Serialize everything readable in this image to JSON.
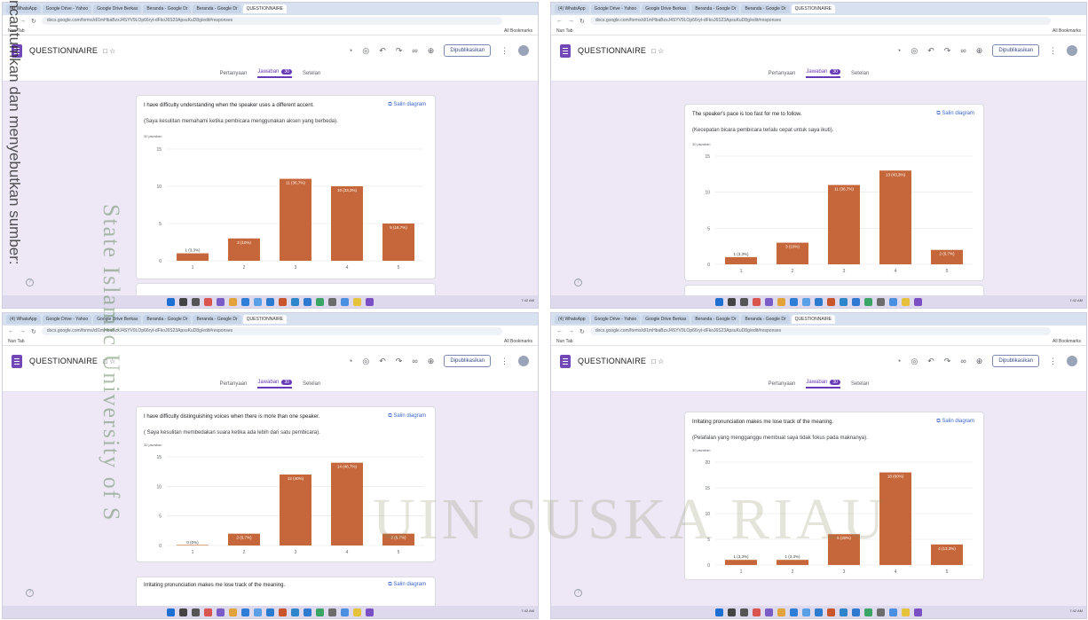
{
  "browser": {
    "tabs": [
      "(4) WhatsApp",
      "Google Drive - Yahoo",
      "Google Drive Berkas",
      "Beranda - Google Dr",
      "Beranda - Google Dr",
      "QUESTIONNAIRE"
    ],
    "url": "docs.google.com/forms/d/1mHbaBzxJ4SYV9LOp66ryt-dFkoJ6S23ApsuKuD8g/edit#responses",
    "bookmark": "Nun Tab",
    "bookmark_right": "All Bookmarks"
  },
  "forms": {
    "title": "QUESTIONNAIRE",
    "publish": "Dipublikasikan",
    "tab_questions": "Pertanyaan",
    "tab_responses": "Jawaban",
    "responses_badge": "30",
    "tab_settings": "Setelan",
    "copy_chart": "Salin diagram"
  },
  "panels": [
    {
      "question": "I have difficulty understanding when the speaker uses a different accent.",
      "translation": "(Saya kesulitan memahami ketika pembicara menggunakan aksen yang berbeda).",
      "responses": "30 jawaban",
      "chart_data": {
        "type": "bar",
        "categories": [
          "1",
          "2",
          "3",
          "4",
          "5"
        ],
        "values": [
          1,
          3,
          11,
          10,
          5
        ],
        "labels": [
          "1 (3,3%)",
          "3 (10%)",
          "11 (36,7%)",
          "10 (33,3%)",
          "5 (16,7%)"
        ],
        "yticks": [
          0,
          5,
          10,
          15
        ],
        "ylim": [
          0,
          15
        ]
      }
    },
    {
      "question": "The speaker's pace is too fast for me to follow.",
      "translation": "(Kecepatan bicara pembicara terlalu cepat untuk saya ikuti).",
      "responses": "30 jawaban",
      "chart_data": {
        "type": "bar",
        "categories": [
          "1",
          "2",
          "3",
          "4",
          "5"
        ],
        "values": [
          1,
          3,
          11,
          13,
          2
        ],
        "labels": [
          "1 (3,3%)",
          "3 (10%)",
          "11 (36,7%)",
          "13 (43,3%)",
          "2 (6,7%)"
        ],
        "yticks": [
          0,
          5,
          10,
          15
        ],
        "ylim": [
          0,
          15
        ]
      }
    },
    {
      "question": "I have difficulty distinguishing voices when there is more than one speaker.",
      "translation": "( Saya kesulitan membedakan suara ketika ada lebih dari satu pembicara).",
      "responses": "30 jawaban",
      "chart_data": {
        "type": "bar",
        "categories": [
          "1",
          "2",
          "3",
          "4",
          "5"
        ],
        "values": [
          0,
          2,
          12,
          14,
          2
        ],
        "labels": [
          "0 (0%)",
          "2 (6,7%)",
          "12 (40%)",
          "14 (46,7%)",
          "2 (6,7%)"
        ],
        "yticks": [
          0,
          5,
          10,
          15
        ],
        "ylim": [
          0,
          15
        ]
      }
    },
    {
      "question": "Irritating pronunciation makes me lose track of the meaning.",
      "translation": "(Pelafalan yang mengganggu membuat saya tidak fokus pada maknanya).",
      "responses": "30 jawaban",
      "chart_data": {
        "type": "bar",
        "categories": [
          "1",
          "2",
          "3",
          "4",
          "5"
        ],
        "values": [
          1,
          1,
          6,
          18,
          4
        ],
        "labels": [
          "1 (3,3%)",
          "1 (3,3%)",
          "6 (20%)",
          "18 (60%)",
          "4 (13,3%)"
        ],
        "yticks": [
          0,
          5,
          10,
          15,
          20
        ],
        "ylim": [
          0,
          20
        ]
      }
    }
  ],
  "next_question": "Irritating pronunciation makes me lose track of the meaning.",
  "overlay": {
    "side_text": "ncantumkan dan menyebutkan sumber:",
    "watermark_vertical": "State Islamic University of S",
    "watermark_horizontal": "UIN SUSKA RIAU"
  },
  "taskbar": {
    "tray_time": "7:42 AM",
    "tray_date": "30/05/2024"
  },
  "colors": {
    "bar": "#c5673a",
    "accent": "#673ab7",
    "link": "#3a66c9"
  }
}
